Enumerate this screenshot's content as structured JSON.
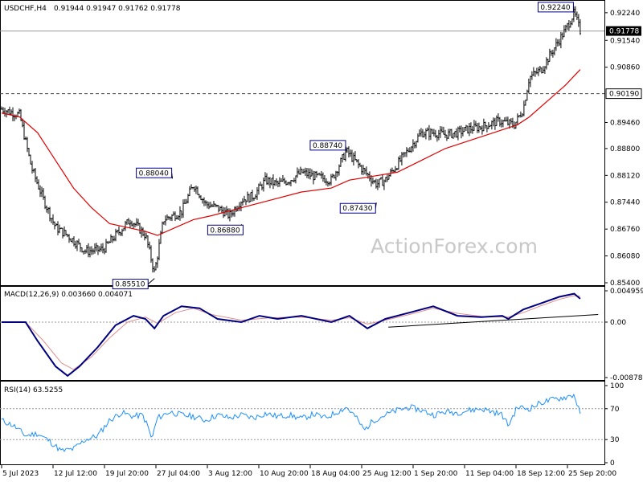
{
  "header": {
    "symbol": "USDCHF,H4",
    "ohlc": "0.91944 0.91947 0.91762 0.91778"
  },
  "watermark": "ActionForex.com",
  "colors": {
    "price": "#000000",
    "ma": "#e00000",
    "macd": "#000080",
    "signal": "#e09090",
    "rsi": "#1e90ff",
    "grid": "#9a9a9a"
  },
  "chart_data": [
    {
      "type": "line",
      "title": "USDCHF,H4",
      "x": [
        "5 Jul 2023",
        "12 Jul 12:00",
        "19 Jul 20:00",
        "27 Jul 04:00",
        "3 Aug 12:00",
        "10 Aug 20:00",
        "18 Aug 04:00",
        "25 Aug 12:00",
        "1 Sep 20:00",
        "11 Sep 04:00",
        "18 Sep 12:00",
        "25 Sep 20:00"
      ],
      "ylim": [
        0.854,
        0.924
      ],
      "yticks": [
        "0.92240",
        "0.91540",
        "0.90860",
        "0.89460",
        "0.88800",
        "0.88120",
        "0.87440",
        "0.86760",
        "0.86080",
        "0.85400"
      ],
      "series": [
        {
          "name": "USDCHF",
          "points": [
            [
              0,
              0.898
            ],
            [
              0.03,
              0.8965
            ],
            [
              0.05,
              0.883
            ],
            [
              0.07,
              0.875
            ],
            [
              0.09,
              0.868
            ],
            [
              0.11,
              0.866
            ],
            [
              0.14,
              0.862
            ],
            [
              0.17,
              0.8625
            ],
            [
              0.19,
              0.866
            ],
            [
              0.215,
              0.87
            ],
            [
              0.24,
              0.866
            ],
            [
              0.255,
              0.8565
            ],
            [
              0.27,
              0.87
            ],
            [
              0.3,
              0.872
            ],
            [
              0.32,
              0.879
            ],
            [
              0.34,
              0.874
            ],
            [
              0.36,
              0.873
            ],
            [
              0.38,
              0.871
            ],
            [
              0.4,
              0.875
            ],
            [
              0.42,
              0.876
            ],
            [
              0.44,
              0.88
            ],
            [
              0.46,
              0.879
            ],
            [
              0.48,
              0.88
            ],
            [
              0.5,
              0.882
            ],
            [
              0.52,
              0.881
            ],
            [
              0.55,
              0.88
            ],
            [
              0.575,
              0.8874
            ],
            [
              0.6,
              0.883
            ],
            [
              0.625,
              0.879
            ],
            [
              0.64,
              0.88
            ],
            [
              0.66,
              0.884
            ],
            [
              0.68,
              0.888
            ],
            [
              0.7,
              0.892
            ],
            [
              0.72,
              0.892
            ],
            [
              0.74,
              0.8915
            ],
            [
              0.76,
              0.892
            ],
            [
              0.78,
              0.893
            ],
            [
              0.8,
              0.8935
            ],
            [
              0.83,
              0.895
            ],
            [
              0.855,
              0.894
            ],
            [
              0.87,
              0.898
            ],
            [
              0.88,
              0.906
            ],
            [
              0.9,
              0.908
            ],
            [
              0.92,
              0.913
            ],
            [
              0.94,
              0.918
            ],
            [
              0.955,
              0.9224
            ],
            [
              0.965,
              0.9178
            ]
          ]
        },
        {
          "name": "MA",
          "points": [
            [
              0,
              0.897
            ],
            [
              0.03,
              0.896
            ],
            [
              0.06,
              0.892
            ],
            [
              0.09,
              0.885
            ],
            [
              0.12,
              0.878
            ],
            [
              0.15,
              0.873
            ],
            [
              0.18,
              0.869
            ],
            [
              0.21,
              0.868
            ],
            [
              0.24,
              0.867
            ],
            [
              0.26,
              0.866
            ],
            [
              0.29,
              0.868
            ],
            [
              0.32,
              0.87
            ],
            [
              0.35,
              0.871
            ],
            [
              0.4,
              0.873
            ],
            [
              0.45,
              0.875
            ],
            [
              0.5,
              0.877
            ],
            [
              0.55,
              0.878
            ],
            [
              0.58,
              0.88
            ],
            [
              0.62,
              0.881
            ],
            [
              0.66,
              0.882
            ],
            [
              0.7,
              0.885
            ],
            [
              0.74,
              0.888
            ],
            [
              0.78,
              0.89
            ],
            [
              0.82,
              0.892
            ],
            [
              0.86,
              0.894
            ],
            [
              0.88,
              0.896
            ],
            [
              0.91,
              0.9
            ],
            [
              0.94,
              0.904
            ],
            [
              0.965,
              0.908
            ]
          ]
        }
      ],
      "annotations": [
        "0.85510",
        "0.88040",
        "0.86880",
        "0.88740",
        "0.87430",
        "0.92240"
      ],
      "hlines": {
        "current": "0.91778",
        "support": "0.90190"
      },
      "grid": false
    },
    {
      "type": "line",
      "title": "MACD(12,26,9) 0.003660 0.004071",
      "ylim": [
        -0.008785,
        0.004959
      ],
      "yticks": [
        "0.004959",
        "0.00",
        "-0.008785"
      ],
      "series": [
        {
          "name": "MACD",
          "points": [
            [
              0,
              0.0
            ],
            [
              0.04,
              0.0
            ],
            [
              0.06,
              -0.003
            ],
            [
              0.09,
              -0.007
            ],
            [
              0.11,
              -0.0085
            ],
            [
              0.13,
              -0.007
            ],
            [
              0.16,
              -0.004
            ],
            [
              0.19,
              -0.0005
            ],
            [
              0.22,
              0.001
            ],
            [
              0.24,
              0.0005
            ],
            [
              0.255,
              -0.001
            ],
            [
              0.27,
              0.001
            ],
            [
              0.3,
              0.0025
            ],
            [
              0.33,
              0.0022
            ],
            [
              0.36,
              0.0005
            ],
            [
              0.4,
              0.0
            ],
            [
              0.43,
              0.001
            ],
            [
              0.46,
              0.0005
            ],
            [
              0.5,
              0.001
            ],
            [
              0.55,
              0.0
            ],
            [
              0.58,
              0.001
            ],
            [
              0.61,
              -0.001
            ],
            [
              0.64,
              0.0005
            ],
            [
              0.68,
              0.0015
            ],
            [
              0.72,
              0.0025
            ],
            [
              0.76,
              0.001
            ],
            [
              0.8,
              0.0008
            ],
            [
              0.835,
              0.001
            ],
            [
              0.845,
              0.0005
            ],
            [
              0.87,
              0.002
            ],
            [
              0.9,
              0.003
            ],
            [
              0.93,
              0.004
            ],
            [
              0.955,
              0.0045
            ],
            [
              0.965,
              0.0037
            ]
          ]
        },
        {
          "name": "Signal",
          "points": [
            [
              0,
              0.0
            ],
            [
              0.04,
              0.0
            ],
            [
              0.07,
              -0.003
            ],
            [
              0.1,
              -0.0065
            ],
            [
              0.12,
              -0.0075
            ],
            [
              0.15,
              -0.0055
            ],
            [
              0.18,
              -0.0025
            ],
            [
              0.21,
              0.0
            ],
            [
              0.24,
              0.0008
            ],
            [
              0.26,
              -0.0002
            ],
            [
              0.29,
              0.0015
            ],
            [
              0.32,
              0.0022
            ],
            [
              0.35,
              0.0012
            ],
            [
              0.4,
              0.0003
            ],
            [
              0.45,
              0.0007
            ],
            [
              0.5,
              0.0008
            ],
            [
              0.55,
              0.0003
            ],
            [
              0.58,
              0.0007
            ],
            [
              0.61,
              -0.0003
            ],
            [
              0.64,
              0.0003
            ],
            [
              0.68,
              0.0012
            ],
            [
              0.72,
              0.0022
            ],
            [
              0.76,
              0.0014
            ],
            [
              0.8,
              0.0009
            ],
            [
              0.845,
              0.0008
            ],
            [
              0.87,
              0.0015
            ],
            [
              0.9,
              0.0026
            ],
            [
              0.93,
              0.0036
            ],
            [
              0.955,
              0.0042
            ],
            [
              0.965,
              0.0041
            ]
          ]
        }
      ]
    },
    {
      "type": "line",
      "title": "RSI(14) 63.5255",
      "ylim": [
        0,
        100
      ],
      "yticks": [
        "100",
        "70",
        "30",
        "0"
      ],
      "series": [
        {
          "name": "RSI",
          "points": [
            [
              0,
              55
            ],
            [
              0.02,
              48
            ],
            [
              0.04,
              35
            ],
            [
              0.06,
              38
            ],
            [
              0.08,
              28
            ],
            [
              0.1,
              15
            ],
            [
              0.12,
              18
            ],
            [
              0.14,
              30
            ],
            [
              0.16,
              35
            ],
            [
              0.18,
              55
            ],
            [
              0.2,
              65
            ],
            [
              0.22,
              60
            ],
            [
              0.235,
              62
            ],
            [
              0.245,
              45
            ],
            [
              0.25,
              30
            ],
            [
              0.26,
              58
            ],
            [
              0.28,
              66
            ],
            [
              0.3,
              62
            ],
            [
              0.32,
              60
            ],
            [
              0.34,
              55
            ],
            [
              0.36,
              62
            ],
            [
              0.38,
              58
            ],
            [
              0.4,
              62
            ],
            [
              0.42,
              58
            ],
            [
              0.44,
              64
            ],
            [
              0.46,
              60
            ],
            [
              0.48,
              62
            ],
            [
              0.5,
              57
            ],
            [
              0.52,
              63
            ],
            [
              0.54,
              58
            ],
            [
              0.56,
              66
            ],
            [
              0.575,
              72
            ],
            [
              0.59,
              60
            ],
            [
              0.605,
              42
            ],
            [
              0.62,
              55
            ],
            [
              0.64,
              62
            ],
            [
              0.66,
              68
            ],
            [
              0.68,
              72
            ],
            [
              0.7,
              68
            ],
            [
              0.72,
              62
            ],
            [
              0.74,
              66
            ],
            [
              0.76,
              65
            ],
            [
              0.78,
              68
            ],
            [
              0.8,
              70
            ],
            [
              0.82,
              66
            ],
            [
              0.835,
              62
            ],
            [
              0.845,
              48
            ],
            [
              0.86,
              72
            ],
            [
              0.88,
              70
            ],
            [
              0.9,
              78
            ],
            [
              0.92,
              82
            ],
            [
              0.94,
              85
            ],
            [
              0.955,
              88
            ],
            [
              0.965,
              63.5255
            ]
          ]
        }
      ]
    }
  ]
}
